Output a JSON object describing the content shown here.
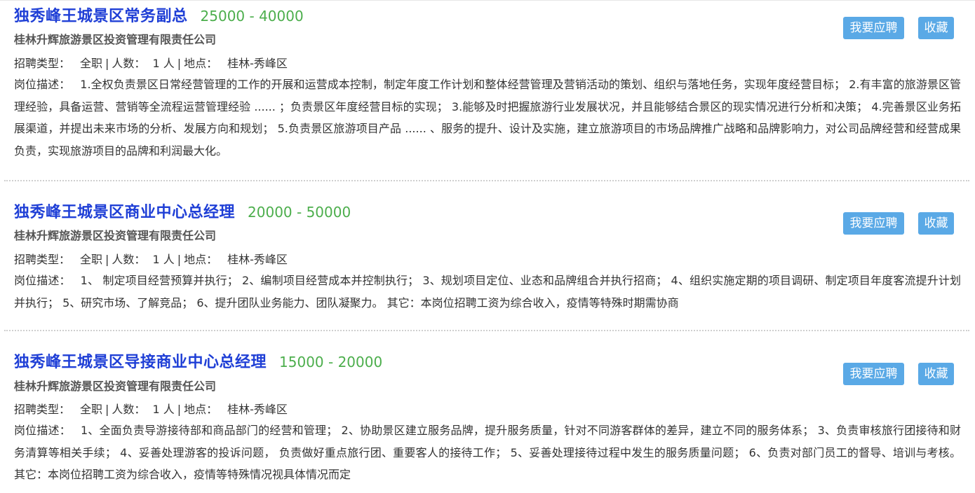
{
  "labels": {
    "type": "招聘类型：",
    "count": "人数：",
    "location": "地点：",
    "desc": "岗位描述：",
    "separator": "|",
    "apply": "我要应聘",
    "favorite": "收藏"
  },
  "jobs": [
    {
      "title": "独秀峰王城景区常务副总",
      "salary": "25000 - 40000",
      "company": "桂林升辉旅游景区投资管理有限责任公司",
      "type": "全职",
      "count": "1 人",
      "location": "桂林-秀峰区",
      "description": "1.全权负责景区日常经营管理的工作的开展和运营成本控制，制定年度工作计划和整体经营管理及营销活动的策划、组织与落地任务，实现年度经营目标； 2.有丰富的旅游景区管理经验，具备运营、营销等全流程运营管理经验 ...... ；负责景区年度经营目标的实现； 3.能够及时把握旅游行业发展状况，并且能够结合景区的现实情况进行分析和决策； 4.完善景区业务拓展渠道，并提出未来市场的分析、发展方向和规划； 5.负责景区旅游项目产品 ...... 、服务的提升、设计及实施，建立旅游项目的市场品牌推广战略和品牌影响力，对公司品牌经营和经营成果负责，实现旅游项目的品牌和利润最大化。"
    },
    {
      "title": "独秀峰王城景区商业中心总经理",
      "salary": "20000 - 50000",
      "company": "桂林升辉旅游景区投资管理有限责任公司",
      "type": "全职",
      "count": "1 人",
      "location": "桂林-秀峰区",
      "description": "1、 制定项目经营预算并执行； 2、编制项目经营成本并控制执行； 3、规划项目定位、业态和品牌组合并执行招商； 4、组织实施定期的项目调研、制定项目年度客流提升计划并执行； 5、研究市场、了解竞品； 6、提升团队业务能力、团队凝聚力。 其它：本岗位招聘工资为综合收入，疫情等特殊时期需协商"
    },
    {
      "title": "独秀峰王城景区导接商业中心总经理",
      "salary": "15000 - 20000",
      "company": "桂林升辉旅游景区投资管理有限责任公司",
      "type": "全职",
      "count": "1 人",
      "location": "桂林-秀峰区",
      "description": "1、全面负责导游接待部和商品部门的经营和管理； 2、协助景区建立服务品牌，提升服务质量，针对不同游客群体的差异，建立不同的服务体系； 3、负责审核旅行团接待和财务清算等相关手续； 4、妥善处理游客的投诉问题， 负责做好重点旅行团、重要客人的接待工作； 5、妥善处理接待过程中发生的服务质量问题； 6、负责对部门员工的督导、培训与考核。 其它：本岗位招聘工资为综合收入，疫情等特殊情况视具体情况而定"
    }
  ]
}
